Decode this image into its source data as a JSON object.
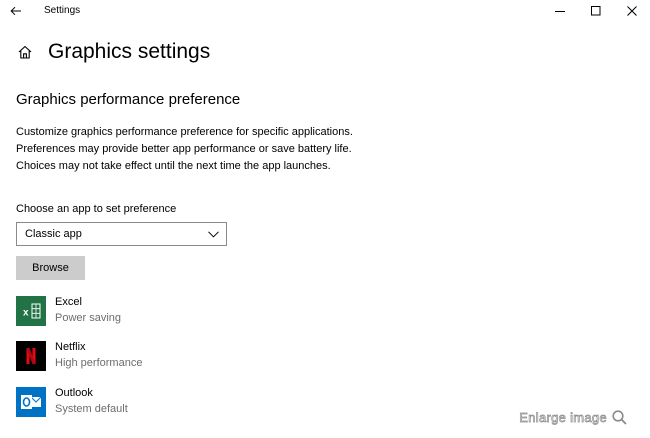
{
  "window": {
    "title": "Settings",
    "controls": [
      "minimize-icon",
      "maximize-icon",
      "close-icon"
    ]
  },
  "header": {
    "title": "Graphics settings"
  },
  "section": {
    "title": "Graphics performance preference",
    "description": "Customize graphics performance preference for specific applications. Preferences may provide better app performance or save battery life. Choices may not take effect until the next time the app launches."
  },
  "chooser": {
    "label": "Choose an app to set preference",
    "selected": "Classic app",
    "browse_label": "Browse"
  },
  "apps": [
    {
      "name": "Excel",
      "preference": "Power saving",
      "icon": "excel-icon",
      "color": "#217346"
    },
    {
      "name": "Netflix",
      "preference": "High performance",
      "icon": "netflix-icon",
      "color": "#000000"
    },
    {
      "name": "Outlook",
      "preference": "System default",
      "icon": "outlook-icon",
      "color": "#0072c6"
    }
  ],
  "watermark": {
    "text": "Enlarge image"
  }
}
